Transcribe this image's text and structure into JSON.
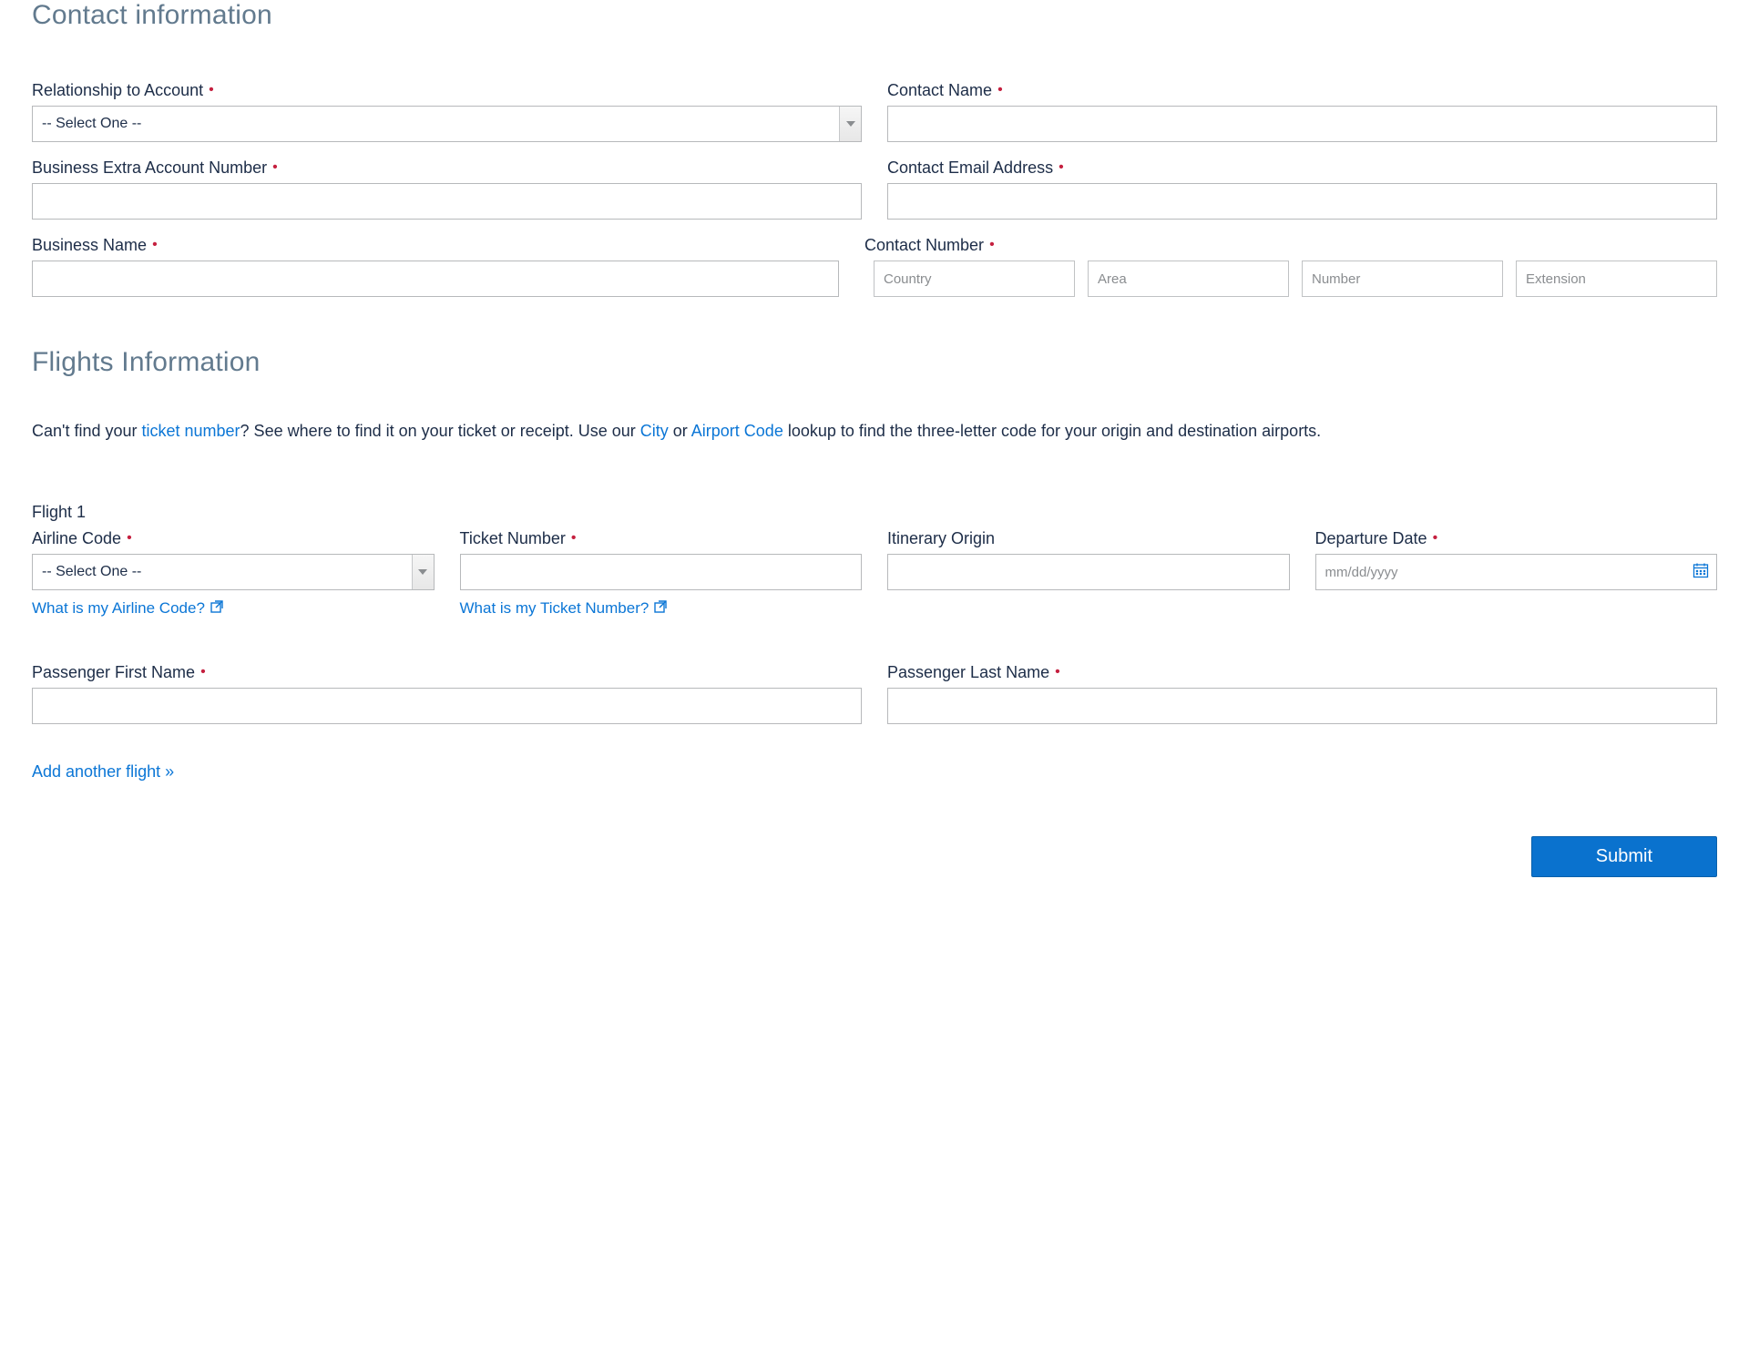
{
  "contact": {
    "title": "Contact information",
    "relationship": {
      "label": "Relationship to Account",
      "value": "-- Select One --"
    },
    "contact_name": {
      "label": "Contact Name"
    },
    "bex_number": {
      "label": "Business Extra Account Number"
    },
    "email": {
      "label": "Contact Email Address"
    },
    "business_name": {
      "label": "Business Name"
    },
    "phone": {
      "label": "Contact Number",
      "country_ph": "Country",
      "area_ph": "Area",
      "number_ph": "Number",
      "ext_ph": "Extension"
    }
  },
  "flights": {
    "title": "Flights Information",
    "help": {
      "p1": "Can't find your ",
      "ticket_link": "ticket number",
      "p2": "? See where to find it on your ticket or receipt. Use our ",
      "city_link": "City",
      "p3": " or ",
      "airport_link": "Airport Code",
      "p4": " lookup to find the three-letter code for your origin and destination airports."
    },
    "flight1": {
      "heading": "Flight 1",
      "airline_code": {
        "label": "Airline Code",
        "value": "-- Select One --",
        "hint": "What is my Airline Code?"
      },
      "ticket_number": {
        "label": "Ticket Number",
        "hint": "What is my Ticket Number?"
      },
      "origin": {
        "label": "Itinerary Origin"
      },
      "departure": {
        "label": "Departure Date",
        "placeholder": "mm/dd/yyyy"
      },
      "first_name": {
        "label": "Passenger First Name"
      },
      "last_name": {
        "label": "Passenger Last Name"
      }
    },
    "add_flight": "Add another flight »"
  },
  "submit_label": "Submit"
}
